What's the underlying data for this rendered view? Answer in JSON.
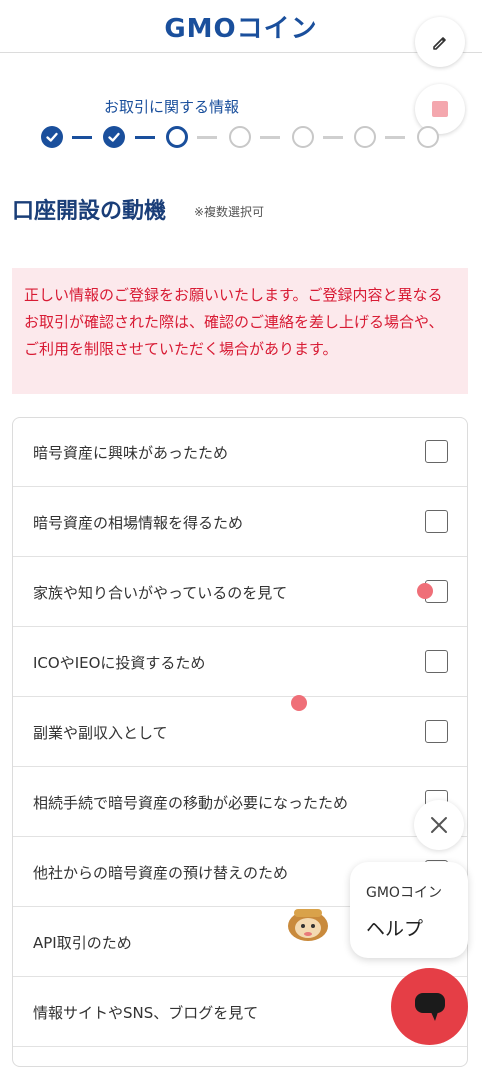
{
  "header": {
    "logo_text": "GMOコイン",
    "brand_color": "#1a4f9c"
  },
  "actions": {
    "edit_icon": "pencil-icon",
    "stop_icon": "stop-square-icon"
  },
  "progress": {
    "current_step_label": "お取引に関する情報",
    "total_steps": 7,
    "completed_steps": 2,
    "current_step": 3
  },
  "section": {
    "title": "口座開設の動機",
    "note": "※複数選択可"
  },
  "alert": {
    "text": "正しい情報のご登録をお願いいたします。ご登録内容と異なるお取引が確認された際は、確認のご連絡を差し上げる場合や、ご利用を制限させていただく場合があります。",
    "color": "#d81b34",
    "background": "#fce9ec"
  },
  "options": [
    {
      "label": "暗号資産に興味があったため",
      "checked": false
    },
    {
      "label": "暗号資産の相場情報を得るため",
      "checked": false
    },
    {
      "label": "家族や知り合いがやっているのを見て",
      "checked": false
    },
    {
      "label": "ICOやIEOに投資するため",
      "checked": false
    },
    {
      "label": "副業や副収入として",
      "checked": false
    },
    {
      "label": "相続手続で暗号資産の移動が必要になったため",
      "checked": false
    },
    {
      "label": "他社からの暗号資産の預け替えのため",
      "checked": false
    },
    {
      "label": "API取引のため",
      "checked": false
    },
    {
      "label": "情報サイトやSNS、ブログを見て",
      "checked": false
    }
  ],
  "help": {
    "brand": "GMOコイン",
    "label": "ヘルプ",
    "close_icon": "close-icon",
    "chat_icon": "chat-bubble-icon"
  },
  "colors": {
    "accent": "#1a4f9c",
    "chat_button": "#e53e46",
    "touch_dot": "#ef6f78"
  }
}
